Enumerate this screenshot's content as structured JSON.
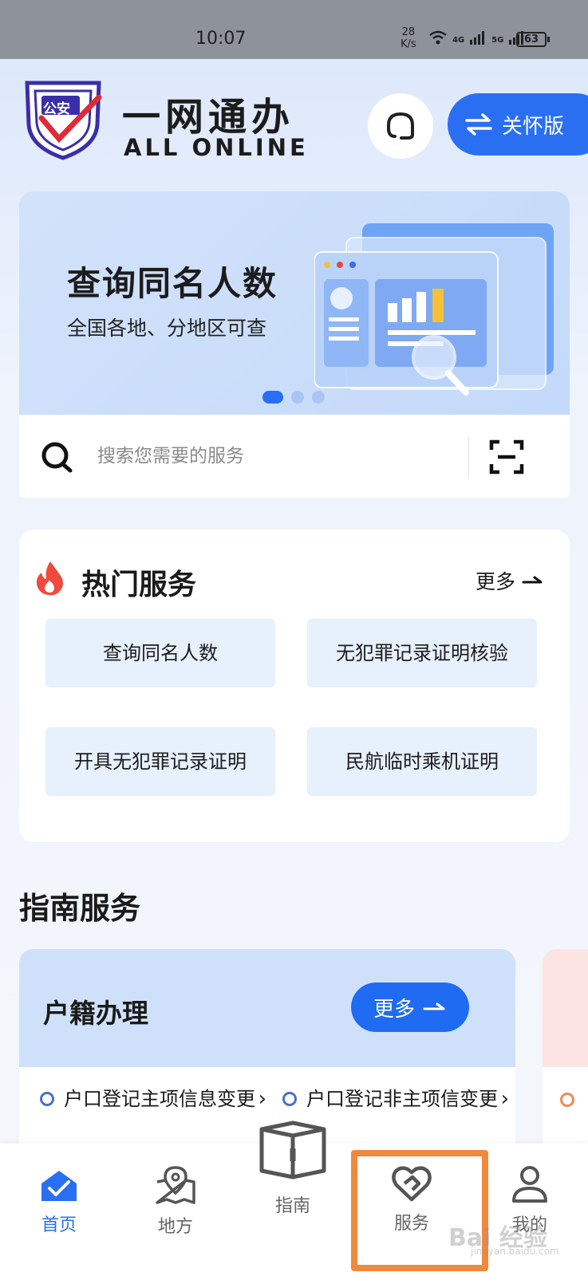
{
  "status_bar": {
    "time": "10:07",
    "net_speed": "28",
    "net_unit": "K/s",
    "battery": "63",
    "signal_labels": [
      "4G",
      "5G"
    ]
  },
  "header": {
    "logo_text": "公安",
    "brand_cn": "一网通办",
    "brand_en": "ALL ONLINE",
    "care_label": "关怀版"
  },
  "banner": {
    "title": "查询同名人数",
    "subtitle": "全国各地、分地区可查",
    "page_index": 1,
    "page_count": 3
  },
  "search": {
    "placeholder": "搜索您需要的服务"
  },
  "hot_services": {
    "title": "热门服务",
    "more_label": "更多",
    "items": [
      "查询同名人数",
      "无犯罪记录证明核验",
      "开具无犯罪记录证明",
      "民航临时乘机证明"
    ]
  },
  "guide": {
    "title": "指南服务",
    "card": {
      "title": "户籍办理",
      "more_label": "更多",
      "items": [
        "户口登记主项信息变更",
        "户口登记非主项信变更"
      ]
    }
  },
  "bottom_nav": {
    "items": [
      {
        "label": "首页",
        "active": true
      },
      {
        "label": "地方",
        "active": false
      },
      {
        "label": "指南",
        "active": false
      },
      {
        "label": "服务",
        "active": false
      },
      {
        "label": "我的",
        "active": false
      }
    ]
  },
  "colors": {
    "accent": "#2a6ff2",
    "highlight": "#f0893c",
    "service_tile": "#e7f0fd",
    "hot_icon": "#f04a3c"
  },
  "watermark": {
    "main": "Bai 经验",
    "sub": "jingyan.baidu.com"
  }
}
